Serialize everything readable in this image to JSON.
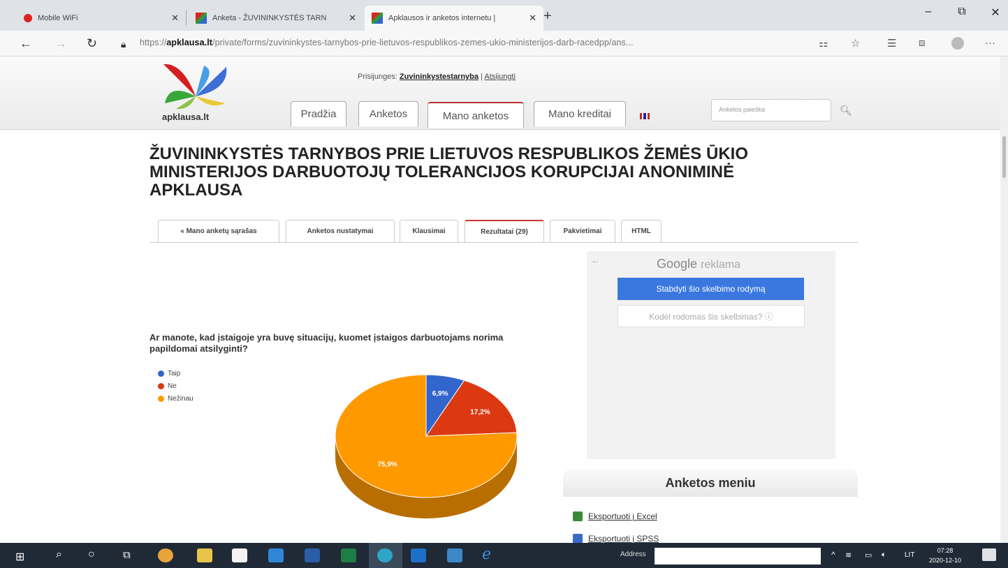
{
  "browser": {
    "tabs": [
      {
        "title": "Mobile WiFi"
      },
      {
        "title": "Anketa - ŽUVININKYSTĖS TARN"
      },
      {
        "title": "Apklausos ir anketos internetu |"
      }
    ],
    "url_prefix": "https://",
    "url_domain": "apklausa.lt",
    "url_rest": "/private/forms/zuvininkystes-tarnybos-prie-lietuvos-respublikos-zemes-ukio-ministerijos-darb-racedpp/ans..."
  },
  "site": {
    "logo_text": "apklausa.lt",
    "login_label": "Prisijunges:",
    "login_user": "Zuvininkystestarnyba",
    "logout": "Atsijungti",
    "nav": [
      "Pradžia",
      "Anketos",
      "Mano anketos",
      "Mano kreditai"
    ],
    "search_placeholder": "Anketos paieška"
  },
  "survey": {
    "title": "ŽUVININKYSTĖS TARNYBOS PRIE LIETUVOS RESPUBLIKOS ŽEMĖS ŪKIO MINISTERIJOS DARBUOTOJŲ TOLERANCIJOS KORUPCIJAI ANONIMINĖ APKLAUSA",
    "tabs": [
      "« Mano anketų sąrašas",
      "Anketos nustatymai",
      "Klausimai",
      "Rezultatai (29)",
      "Pakvietimai",
      "HTML"
    ]
  },
  "question": {
    "text": "Ar manote, kad įstaigoje yra buvę situacijų, kuomet įstaigos darbuotojams norima papildomai atsilyginti?"
  },
  "chart_data": {
    "type": "pie",
    "categories": [
      "Taip",
      "Ne",
      "Nežinau"
    ],
    "values": [
      6.9,
      17.2,
      75.9
    ],
    "labels": [
      "6,9%",
      "17,2%",
      "75,9%"
    ],
    "colors": [
      "#3366cc",
      "#dc3912",
      "#ff9900"
    ],
    "legend": "top-left",
    "style": "3d"
  },
  "ad": {
    "google": "Google",
    "reklama": "reklama",
    "stop_button": "Stabdyti šio skelbimo rodymą",
    "why_button": "Kodėl rodomas šis skelbimas? ⓘ"
  },
  "menu": {
    "title": "Anketos meniu",
    "links": [
      "Eksportuoti į Excel",
      "Eksportuoti į SPSS"
    ]
  },
  "taskbar": {
    "address_label": "Address",
    "lang": "LIT",
    "time": "07:28",
    "date": "2020-12-10"
  }
}
